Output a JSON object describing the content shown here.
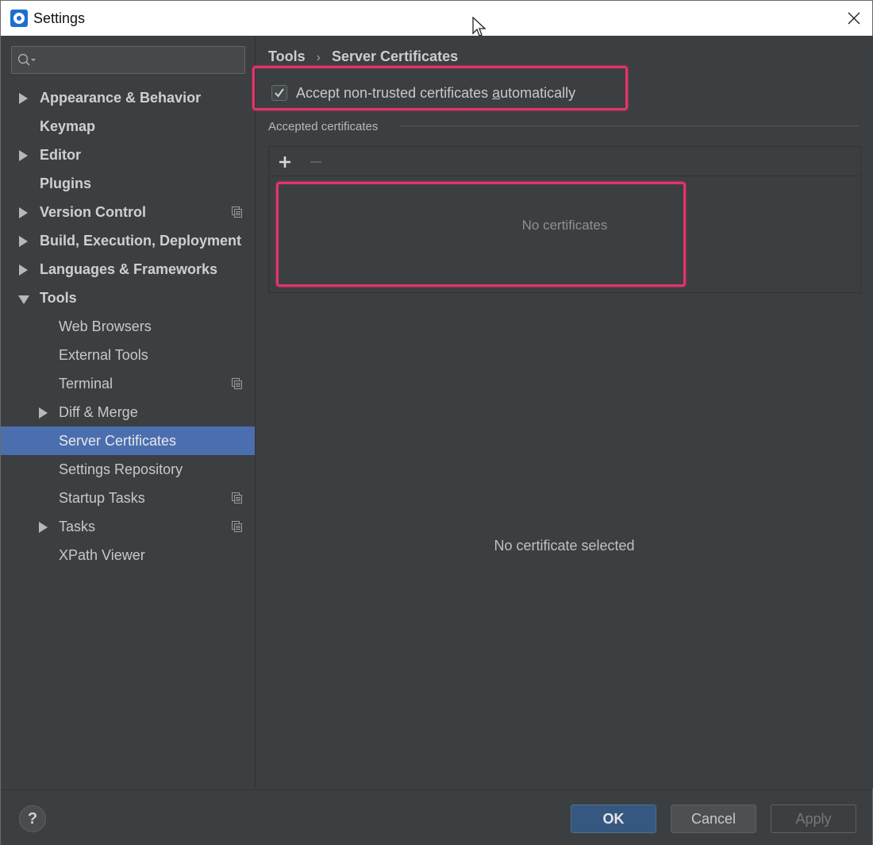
{
  "window": {
    "title": "Settings"
  },
  "search": {
    "placeholder": ""
  },
  "sidebar": {
    "items": [
      {
        "label": "Appearance & Behavior"
      },
      {
        "label": "Keymap"
      },
      {
        "label": "Editor"
      },
      {
        "label": "Plugins"
      },
      {
        "label": "Version Control"
      },
      {
        "label": "Build, Execution, Deployment"
      },
      {
        "label": "Languages & Frameworks"
      },
      {
        "label": "Tools"
      },
      {
        "label": "Web Browsers"
      },
      {
        "label": "External Tools"
      },
      {
        "label": "Terminal"
      },
      {
        "label": "Diff & Merge"
      },
      {
        "label": "Server Certificates"
      },
      {
        "label": "Settings Repository"
      },
      {
        "label": "Startup Tasks"
      },
      {
        "label": "Tasks"
      },
      {
        "label": "XPath Viewer"
      }
    ]
  },
  "breadcrumb": {
    "parent": "Tools",
    "current": "Server Certificates"
  },
  "options": {
    "accept_label_prefix": "Accept non-trusted certificates ",
    "accept_label_mnemonic": "a",
    "accept_label_suffix": "utomatically",
    "accept_checked": true
  },
  "certificates": {
    "section_title": "Accepted certificates",
    "empty_text": "No certificates",
    "no_selection_text": "No certificate selected"
  },
  "footer": {
    "help": "?",
    "ok": "OK",
    "cancel": "Cancel",
    "apply": "Apply"
  },
  "colors": {
    "selection": "#4b6eaf",
    "highlight": "#e5336b",
    "ok_button": "#365880"
  }
}
